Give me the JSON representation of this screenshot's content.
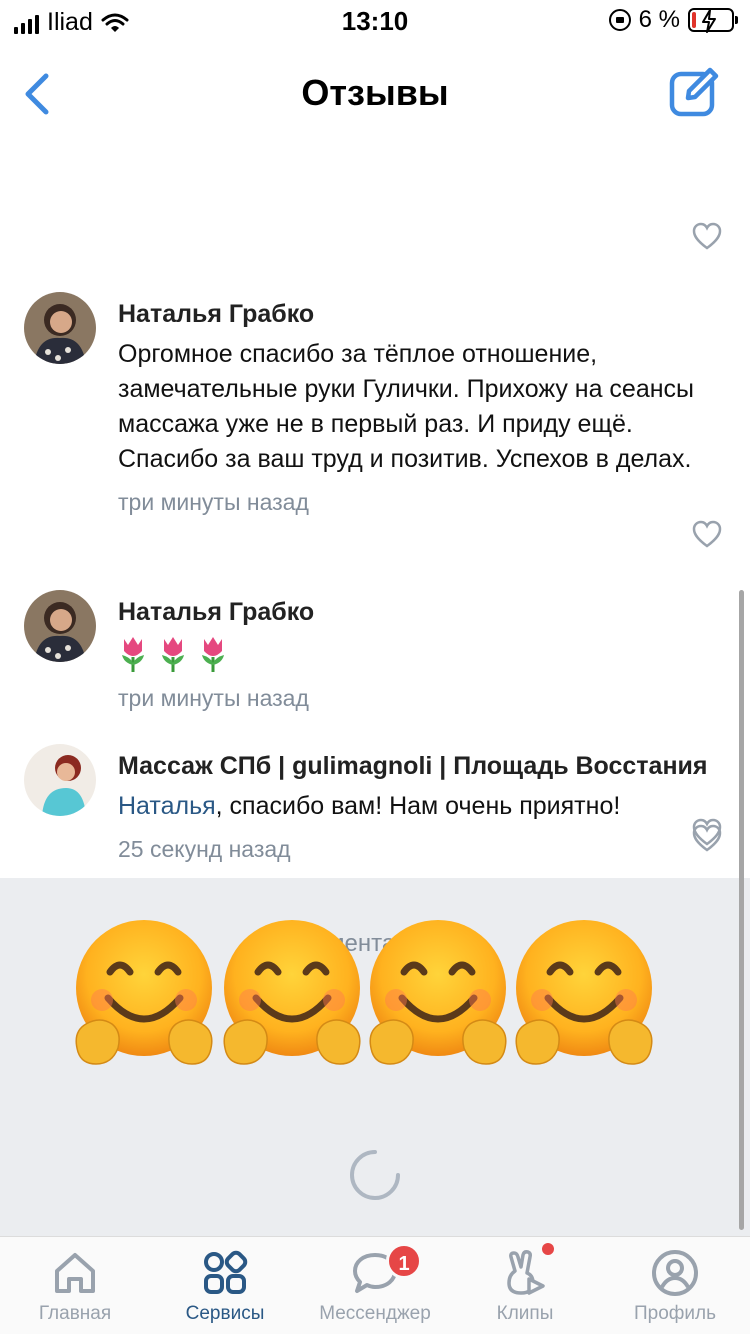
{
  "status_bar": {
    "carrier": "Iliad",
    "time": "13:10",
    "battery": "6 %"
  },
  "nav": {
    "title": "Отзывы",
    "back_icon": "chevron-left-icon",
    "edit_icon": "compose-icon"
  },
  "comments": [
    {
      "author": "Наталья Грабко",
      "text": "Оргомное спасибо за тёплое отношение, замечательные руки Гулички. Прихожу на сеансы массажа уже не в первый раз. И приду ещё. Спасибо за ваш труд и позитив. Успехов в делах.",
      "time": "три минуты назад"
    },
    {
      "author": "Наталья Грабко",
      "emoji": "🌷🌷🌷",
      "time": "три минуты назад"
    },
    {
      "author": "Массаж СПб | gulimagnoli | Площадь Восстания",
      "mention": "Наталья",
      "text": ", спасибо вам! Нам очень приятно!",
      "time": "25 секунд назад"
    }
  ],
  "grey_area": {
    "label_fragment": "иментарии"
  },
  "tabbar": {
    "items": [
      {
        "label": "Главная",
        "icon": "home-icon"
      },
      {
        "label": "Сервисы",
        "icon": "services-grid-icon"
      },
      {
        "label": "Мессенджер",
        "icon": "chat-bubble-icon",
        "badge": "1"
      },
      {
        "label": "Клипы",
        "icon": "clips-icon"
      },
      {
        "label": "Профиль",
        "icon": "profile-icon"
      }
    ],
    "active_index": 1
  },
  "colors": {
    "accent": "#2a5885",
    "link": "#2a5885",
    "nav_icon": "#3f8ae0",
    "muted": "#818c99",
    "badge": "#e64646",
    "grey_bg": "#ebedf0"
  }
}
